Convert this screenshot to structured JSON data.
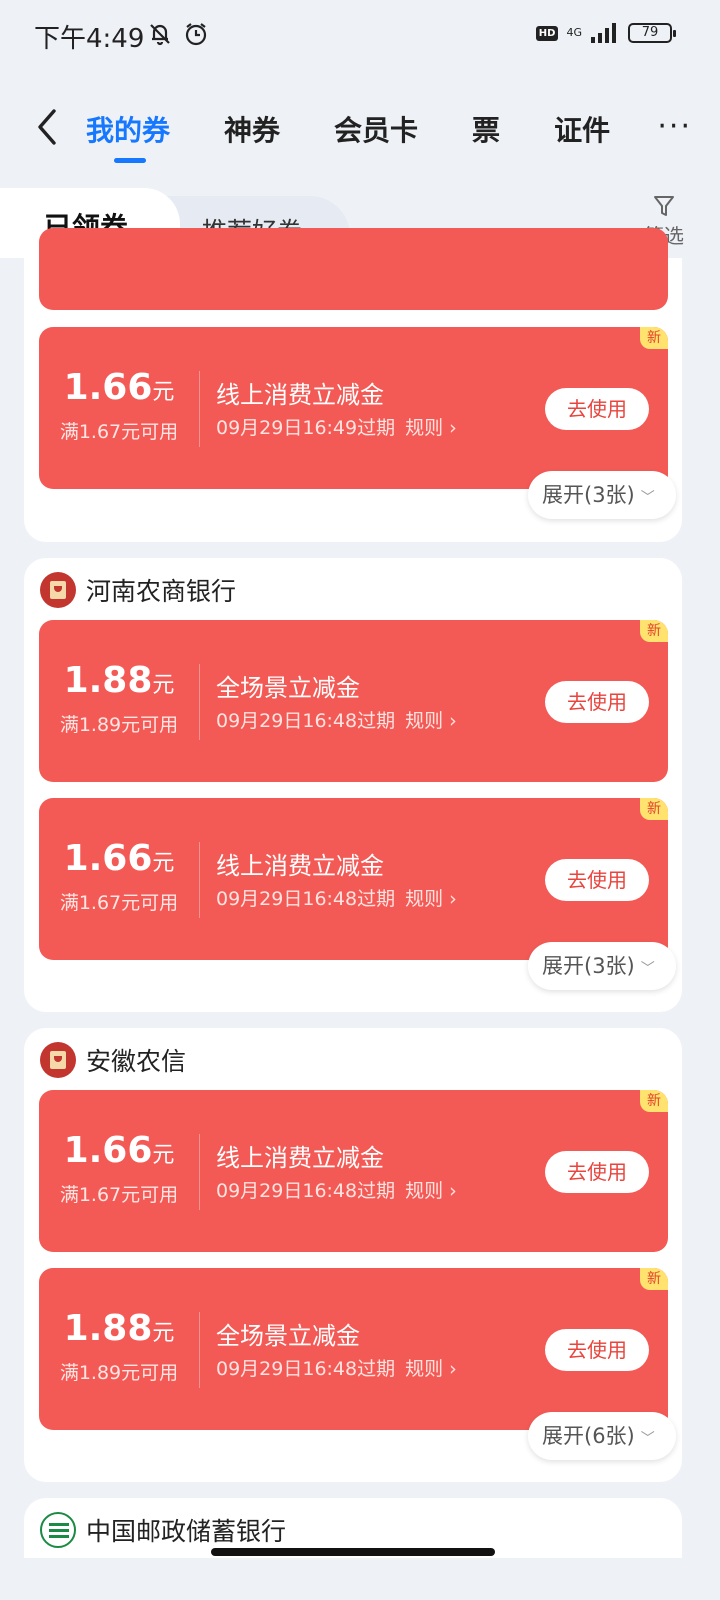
{
  "status": {
    "time": "下午4:49",
    "hd": "HD",
    "network": "4G",
    "battery": "79"
  },
  "nav": {
    "tabs": [
      "我的券",
      "神券",
      "会员卡",
      "票",
      "证件"
    ],
    "more": "···"
  },
  "subtabs": {
    "active": "已领券",
    "other": "推荐好券",
    "filter": "筛选"
  },
  "groups": [
    {
      "coupons": [
        {
          "amount": "1.66",
          "unit": "元",
          "cond": "满1.67元可用",
          "name": "线上消费立减金",
          "expire": "09月29日16:49过期",
          "rule": "规则",
          "use": "去使用",
          "tag": "新"
        }
      ],
      "expand": "展开(3张)"
    },
    {
      "bank": "河南农商银行",
      "coupons": [
        {
          "amount": "1.88",
          "unit": "元",
          "cond": "满1.89元可用",
          "name": "全场景立减金",
          "expire": "09月29日16:48过期",
          "rule": "规则",
          "use": "去使用",
          "tag": "新"
        },
        {
          "amount": "1.66",
          "unit": "元",
          "cond": "满1.67元可用",
          "name": "线上消费立减金",
          "expire": "09月29日16:48过期",
          "rule": "规则",
          "use": "去使用",
          "tag": "新"
        }
      ],
      "expand": "展开(3张)"
    },
    {
      "bank": "安徽农信",
      "coupons": [
        {
          "amount": "1.66",
          "unit": "元",
          "cond": "满1.67元可用",
          "name": "线上消费立减金",
          "expire": "09月29日16:48过期",
          "rule": "规则",
          "use": "去使用",
          "tag": "新"
        },
        {
          "amount": "1.88",
          "unit": "元",
          "cond": "满1.89元可用",
          "name": "全场景立减金",
          "expire": "09月29日16:48过期",
          "rule": "规则",
          "use": "去使用",
          "tag": "新"
        }
      ],
      "expand": "展开(6张)"
    },
    {
      "bank": "中国邮政储蓄银行"
    }
  ],
  "colors": {
    "accent": "#1677ff",
    "coupon": "#f45a55",
    "new_tag": "#ffe36e"
  }
}
